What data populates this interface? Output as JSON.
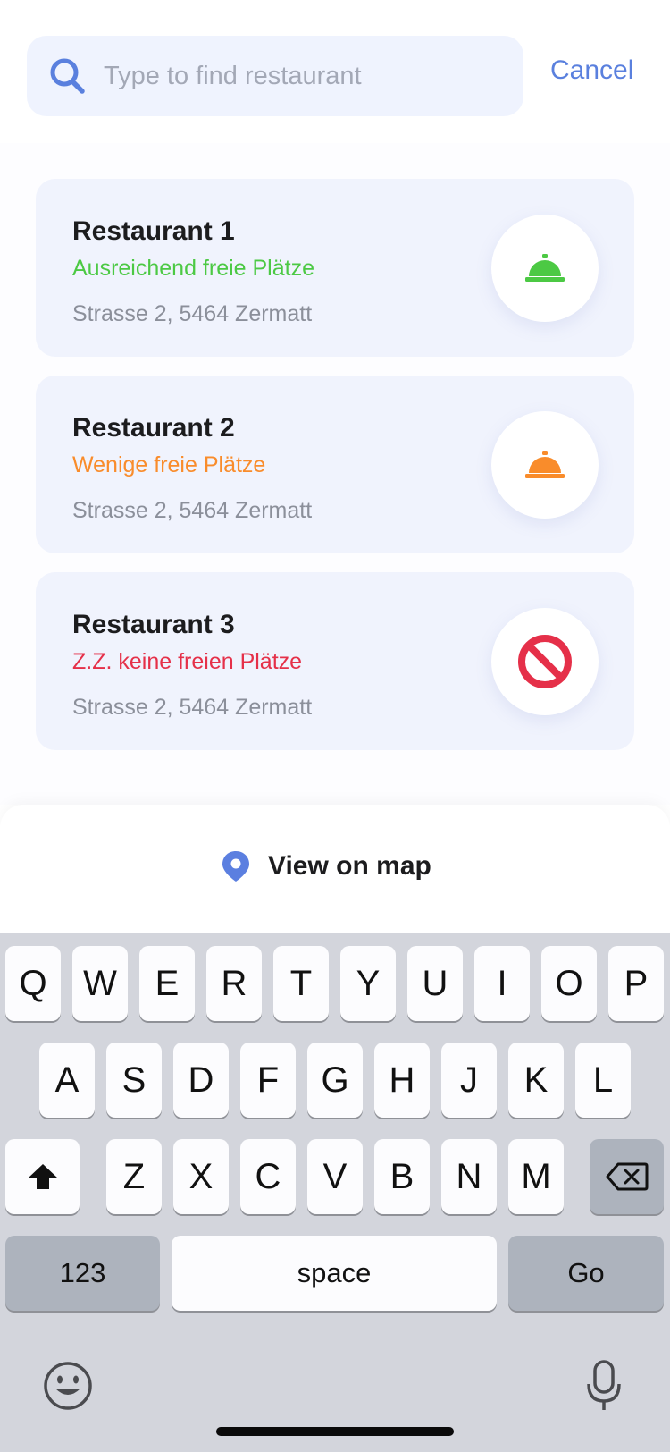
{
  "search": {
    "placeholder": "Type to find restaurant",
    "value": "",
    "cancel_label": "Cancel"
  },
  "restaurants": [
    {
      "name": "Restaurant 1",
      "status": "Ausreichend freie Plätze",
      "status_color": "#4cc944",
      "address": "Strasse 2, 5464 Zermatt",
      "icon": "service-bell-icon"
    },
    {
      "name": "Restaurant 2",
      "status": "Wenige freie Plätze",
      "status_color": "#f98c2b",
      "address": "Strasse 2, 5464 Zermatt",
      "icon": "service-bell-icon"
    },
    {
      "name": "Restaurant 3",
      "status": "Z.Z. keine freien Plätze",
      "status_color": "#e53049",
      "address": "Strasse 2, 5464 Zermatt",
      "icon": "no-entry-icon"
    }
  ],
  "map": {
    "label": "View on map",
    "icon": "location-pin-icon",
    "icon_color": "#5b7fe0"
  },
  "keyboard": {
    "row1": [
      "Q",
      "W",
      "E",
      "R",
      "T",
      "Y",
      "U",
      "I",
      "O",
      "P"
    ],
    "row2": [
      "A",
      "S",
      "D",
      "F",
      "G",
      "H",
      "J",
      "K",
      "L"
    ],
    "row3": [
      "Z",
      "X",
      "C",
      "V",
      "B",
      "N",
      "M"
    ],
    "numbers_label": "123",
    "space_label": "space",
    "go_label": "Go",
    "icons": [
      "shift-icon",
      "backspace-icon",
      "emoji-icon",
      "microphone-icon"
    ]
  },
  "colors": {
    "accent": "#5a80de",
    "card_bg": "#f0f3fd"
  }
}
